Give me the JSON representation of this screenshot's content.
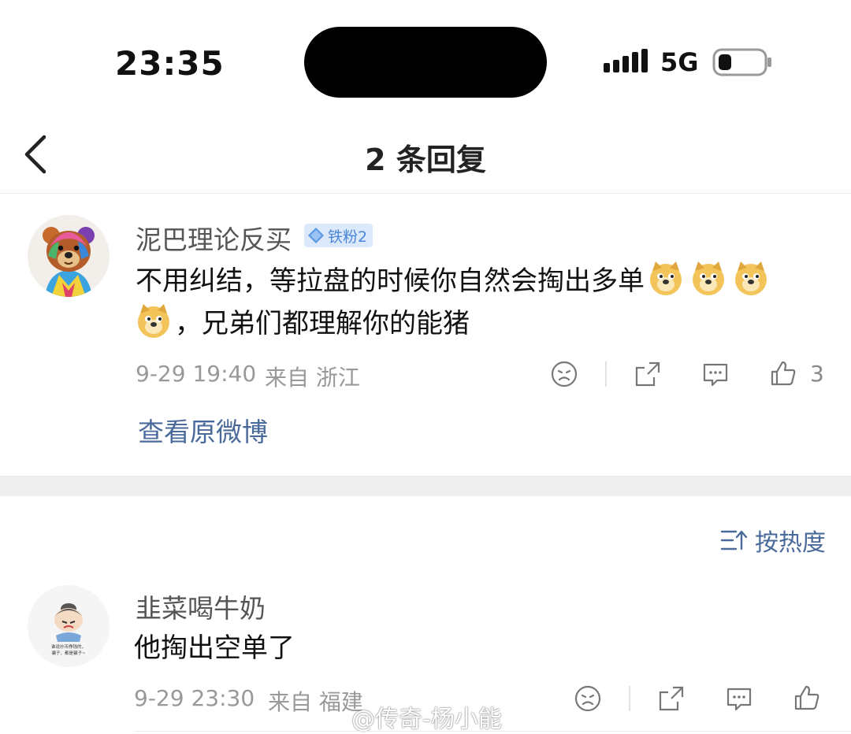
{
  "status_bar": {
    "time": "23:35",
    "network": "5G"
  },
  "nav": {
    "title": "2 条回复"
  },
  "main_comment": {
    "username": "泥巴理论反买",
    "badge": "铁粉2",
    "text_part1": "不用纠结，等拉盘的时候你自然会掏出多单",
    "text_part2": "，兄弟们都理解你的能猪",
    "date": "9-29 19:40",
    "location": "来自 浙江",
    "likes": "3",
    "view_original": "查看原微博"
  },
  "sort": {
    "label": "按热度"
  },
  "reply": {
    "username": "韭菜喝牛奶",
    "text": "他掏出空单了",
    "date": "9-29 23:30",
    "location": "来自 福建",
    "avatar_caption": "谁说炒币挣钱的，骗子，都是骗子~"
  },
  "watermark": "@传奇-杨小能",
  "colors": {
    "link": "#4a6a9b",
    "badge_bg": "#dce9fb",
    "badge_text": "#4a86d8",
    "meta": "#999999"
  }
}
